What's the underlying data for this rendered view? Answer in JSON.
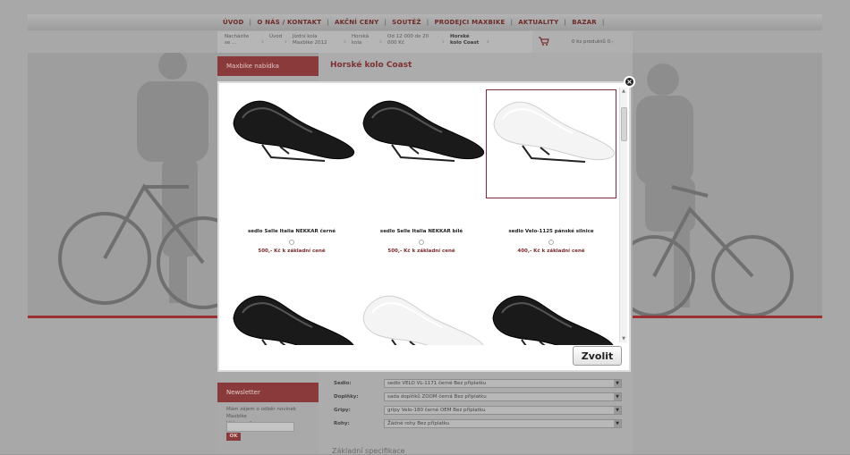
{
  "nav": {
    "items": [
      "ÚVOD",
      "O NÁS / KONTAKT",
      "AKČNÍ CENY",
      "SOUTĚŽ",
      "PRODEJCI MAXBIKE",
      "AKTUALITY",
      "BAZAR"
    ]
  },
  "breadcrumb": {
    "items": [
      "Nacházíte se ...",
      "Úvod",
      "Jízdní kola Maxbike 2012",
      "Horská kola",
      "Od 12 000 do 20 000 Kč",
      "Horské kolo Coast"
    ]
  },
  "cart": {
    "icon": "cart-icon",
    "text": "0 ks produktů 0,-"
  },
  "sidebar": {
    "menu_title": "Maxbike nabídka"
  },
  "product": {
    "title": "Horské kolo Coast"
  },
  "options": [
    {
      "label": "Sedlo:",
      "value": "sedlo VELO VL-1171 černé Bez příplatku"
    },
    {
      "label": "Doplňky:",
      "value": "sada doplňků ZOOM černá Bez příplatku"
    },
    {
      "label": "Gripy:",
      "value": "gripy Velo-180 černé OEM Bez příplatku"
    },
    {
      "label": "Rohy:",
      "value": "Žádné rohy Bez příplatku"
    }
  ],
  "spec_title": "Základní specifikace",
  "newsletter": {
    "title": "Newsletter",
    "text": "Mám zájem o odběr novinek Maxbike",
    "email_label": "Váš e-mail:",
    "email_value": "",
    "ok_label": "OK"
  },
  "modal": {
    "close_icon": "close-icon",
    "choose_label": "Zvolit",
    "products": [
      {
        "name": "sedlo Selle Italia NEKKAR černé",
        "price": "500,- Kč k základní ceně",
        "color": "#1a1a1a",
        "selected": false
      },
      {
        "name": "sedlo Selle Italia NEKKAR bílé",
        "price": "500,- Kč k základní ceně",
        "color": "#1a1a1a",
        "selected": false
      },
      {
        "name": "sedlo Velo-1125 pánské silnice",
        "price": "400,- Kč k základní ceně",
        "color": "#f4f4f4",
        "selected": true
      },
      {
        "name": "",
        "price": "",
        "color": "#1a1a1a",
        "selected": false
      },
      {
        "name": "",
        "price": "",
        "color": "#f4f4f4",
        "selected": false
      },
      {
        "name": "",
        "price": "",
        "color": "#1a1a1a",
        "selected": false
      }
    ]
  },
  "colors": {
    "accent": "#8a3a3a",
    "overlay": "#a8a8a8"
  }
}
